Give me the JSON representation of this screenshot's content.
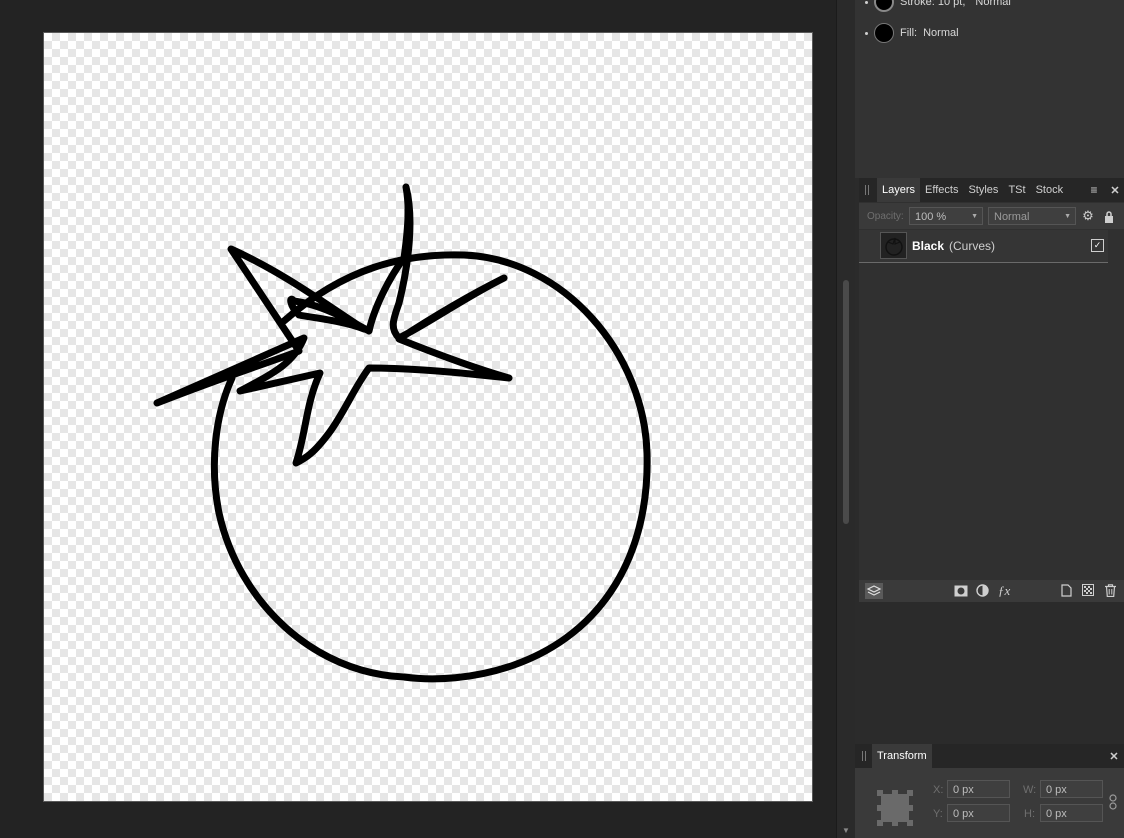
{
  "appearance": {
    "stroke_label": "Stroke:",
    "stroke_value": "10 pt,",
    "stroke_mode": "Normal",
    "fill_label": "Fill:",
    "fill_mode": "Normal"
  },
  "layers_panel": {
    "tabs": [
      "Layers",
      "Effects",
      "Styles",
      "TSt",
      "Stock"
    ],
    "active_tab": "Layers",
    "opacity_label": "Opacity:",
    "opacity_value": "100 %",
    "blend_mode": "Normal",
    "layer": {
      "name": "Black",
      "type": "(Curves)",
      "visible": true
    }
  },
  "transform_panel": {
    "title": "Transform",
    "x_label": "X:",
    "x_value": "0 px",
    "y_label": "Y:",
    "y_value": "0 px",
    "w_label": "W:",
    "w_value": "0 px",
    "h_label": "H:",
    "h_value": "0 px"
  },
  "icons": {
    "panel_menu": "menu-icon",
    "panel_close": "close-icon",
    "settings": "gear-icon",
    "lock": "lock-icon"
  }
}
